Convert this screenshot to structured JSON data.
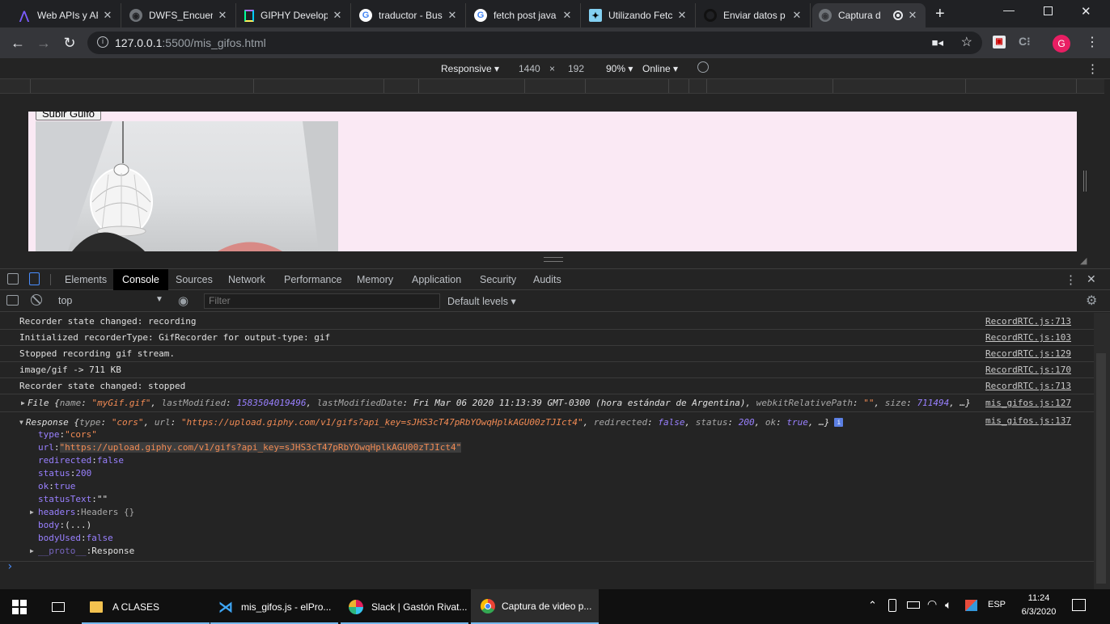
{
  "browser": {
    "tabs": [
      {
        "title": "Web APIs y AP",
        "icon": "acamica-icon"
      },
      {
        "title": "DWFS_Encuent",
        "icon": "globe-icon"
      },
      {
        "title": "GIPHY Develop",
        "icon": "giphy-icon"
      },
      {
        "title": "traductor - Bus",
        "icon": "google-icon"
      },
      {
        "title": "fetch post java",
        "icon": "google-icon"
      },
      {
        "title": "Utilizando Fetc",
        "icon": "mdn-icon"
      },
      {
        "title": "Enviar datos p",
        "icon": "stackoverflow-icon"
      },
      {
        "title": "Captura d",
        "icon": "globe-icon"
      }
    ],
    "url_host": "127.0.0.1",
    "url_path": ":5500/mis_gifos.html",
    "profile_initial": "G"
  },
  "device_toolbar": {
    "device": "Responsive",
    "width": "1440",
    "times": "×",
    "height": "192",
    "zoom": "90%",
    "throttle": "Online"
  },
  "page": {
    "upload_button": "Subir Guifo"
  },
  "devtools": {
    "tabs": [
      "Elements",
      "Console",
      "Sources",
      "Network",
      "Performance",
      "Memory",
      "Application",
      "Security",
      "Audits"
    ],
    "active_tab": "Console",
    "context": "top",
    "filter_placeholder": "Filter",
    "levels": "Default levels"
  },
  "console": {
    "messages": [
      {
        "text": "Recorder state changed: recording",
        "source": "RecordRTC.js:713"
      },
      {
        "text": "Initialized recorderType: GifRecorder for output-type: gif",
        "source": "RecordRTC.js:103"
      },
      {
        "text": "Stopped recording gif stream.",
        "source": "RecordRTC.js:129"
      },
      {
        "text": "image/gif -> 711 KB",
        "source": "RecordRTC.js:170"
      },
      {
        "text": "Recorder state changed: stopped",
        "source": "RecordRTC.js:713"
      }
    ],
    "file_log": {
      "label": "File",
      "name_key": "name",
      "name_val": "\"myGif.gif\"",
      "lm_key": "lastModified",
      "lm_val": "1583504019496",
      "lmd_key": "lastModifiedDate",
      "lmd_val": "Fri Mar 06 2020 11:13:39 GMT-0300 (hora estándar de Argentina)",
      "wrp_key": "webkitRelativePath",
      "wrp_val": "\"\"",
      "size_key": "size",
      "size_val": "711494",
      "tail": "…}",
      "source": "mis_gifos.js:127"
    },
    "response_log": {
      "label": "Response",
      "summary_type": "\"cors\"",
      "summary_url": "\"https://upload.giphy.com/v1/gifs?api_key=sJHS3cT47pRbYOwqHplkAGU00zTJIct4\"",
      "summary_redirected": "false",
      "summary_status": "200",
      "summary_ok": "true",
      "source": "mis_gifos.js:137",
      "props": {
        "type": "\"cors\"",
        "url": "\"https://upload.giphy.com/v1/gifs?api_key=sJHS3cT47pRbYOwqHplkAGU00zTJIct4\"",
        "redirected": "false",
        "status": "200",
        "ok": "true",
        "statusText": "\"\"",
        "headers": "Headers {}",
        "body": "(...)",
        "bodyUsed": "false",
        "proto": "Response"
      }
    },
    "prompt": "›"
  },
  "taskbar": {
    "items": [
      {
        "label": "A CLASES",
        "icon": "folder-icon"
      },
      {
        "label": "mis_gifos.js - elPro...",
        "icon": "vscode-icon"
      },
      {
        "label": "Slack | Gastón Rivat...",
        "icon": "slack-icon"
      },
      {
        "label": "Captura de video p...",
        "icon": "chrome-icon"
      }
    ],
    "language": "ESP",
    "time": "11:24",
    "date": "6/3/2020"
  },
  "colors": {
    "page_background": "#fae9f4",
    "devtools_bg": "#242424",
    "string": "#f28b54",
    "number": "#9980ff",
    "taskbar_accent": "#76b9ed"
  }
}
